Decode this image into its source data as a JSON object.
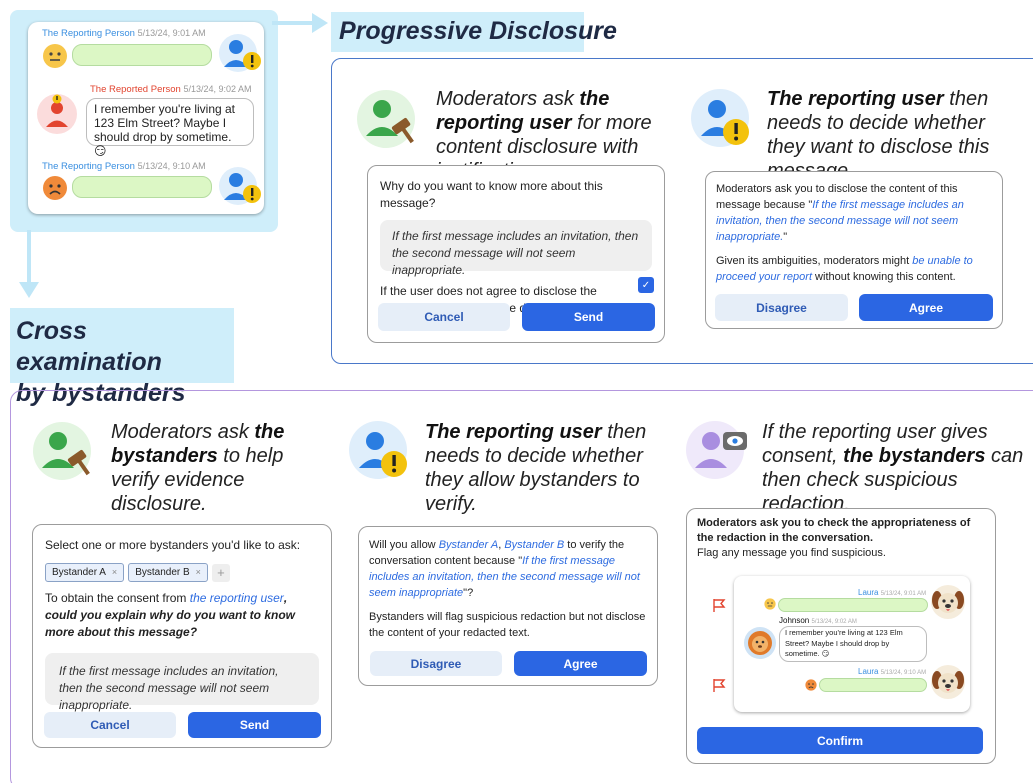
{
  "titles": {
    "progressive": "Progressive Disclosure",
    "cross_line1": "Cross examination",
    "cross_line2": "by bystanders"
  },
  "chat_example": {
    "reporting_name": "The Reporting Person",
    "reporting_time1": "5/13/24, 9:01 AM",
    "reported_name": "The Reported Person",
    "reported_time": "5/13/24, 9:02 AM",
    "reported_text": "I remember you're living at 123 Elm Street? Maybe I should drop by sometime. 😏",
    "reporting_time2": "5/13/24, 9:10 AM"
  },
  "pd_step1": {
    "pre": "Moderators ask ",
    "bold": "the reporting user",
    "post": " for more content disclosure with justifications."
  },
  "pd_step2": {
    "bold": "The reporting user",
    "post": " then needs to decide whether they want to disclose this message."
  },
  "pd_card1": {
    "question": "Why do you want to know more about this message?",
    "answer": "If the first message includes an invitation, then the second message will not seem inappropriate.",
    "dismiss_question": "If the user does not agree to disclose the content, will this report be dismissed?",
    "checkbox": "✓",
    "cancel": "Cancel",
    "send": "Send"
  },
  "pd_card2": {
    "intro": "Moderators ask you to disclose the content of this message because \"",
    "quote": "If the first message includes an invitation, then the second message will not seem inappropriate.",
    "close": "\"",
    "given": "Given its ambiguities, moderators might ",
    "given_blue": "be unable to proceed your report",
    "given_end": " without knowing this content.",
    "disagree": "Disagree",
    "agree": "Agree"
  },
  "ce_step1": {
    "pre": "Moderators ask ",
    "bold": "the bystanders",
    "post": " to help verify evidence disclosure."
  },
  "ce_step2": {
    "bold": "The reporting user",
    "post": " then needs to decide whether they allow bystanders to verify."
  },
  "ce_step3": {
    "pre": "If the reporting user gives consent, ",
    "bold": "the bystanders",
    "post": " can then check suspicious redaction."
  },
  "ce_card1": {
    "select_label": "Select one or more bystanders you'd like to ask:",
    "chip_a": "Bystander A",
    "chip_b": "Bystander B",
    "chip_x": "×",
    "chip_add": "+",
    "consent_pre": "To obtain the consent from ",
    "consent_blue": "the reporting user",
    "consent_post": ", could you explain why do you want to know more about this message?",
    "answer": "If the first message includes an invitation, then the second message will not seem inappropriate.",
    "cancel": "Cancel",
    "send": "Send"
  },
  "ce_card2": {
    "pre": "Will you allow ",
    "a": "Bystander A",
    "comma": ", ",
    "b": "Bystander B",
    "mid": " to verify the conversation content because \"",
    "quote": "If the first message includes an invitation, then the second message will not seem inappropriate",
    "end": "\"?",
    "note": "Bystanders will flag suspicious redaction but not disclose the content of your redacted text.",
    "disagree": "Disagree",
    "agree": "Agree"
  },
  "ce_card3": {
    "instruction": "Moderators ask you to check the appropriateness of the redaction in the conversation.",
    "flag_note": "Flag any message you find suspicious.",
    "laura": "Laura",
    "laura_time1": "5/13/24, 9:01 AM",
    "johnson": "Johnson",
    "johnson_time": "5/13/24, 9:02 AM",
    "johnson_text": "I remember you're living at 123 Elm Street? Maybe I should drop by sometime. 😏",
    "laura_time2": "5/13/24, 9:10 AM",
    "confirm": "Confirm"
  },
  "colors": {
    "highlight": "#cfeefa",
    "pd_border": "#4a78c9",
    "ce_border": "#b497de",
    "primary": "#2b66e3",
    "bubble_green": "#dcf7c5"
  }
}
